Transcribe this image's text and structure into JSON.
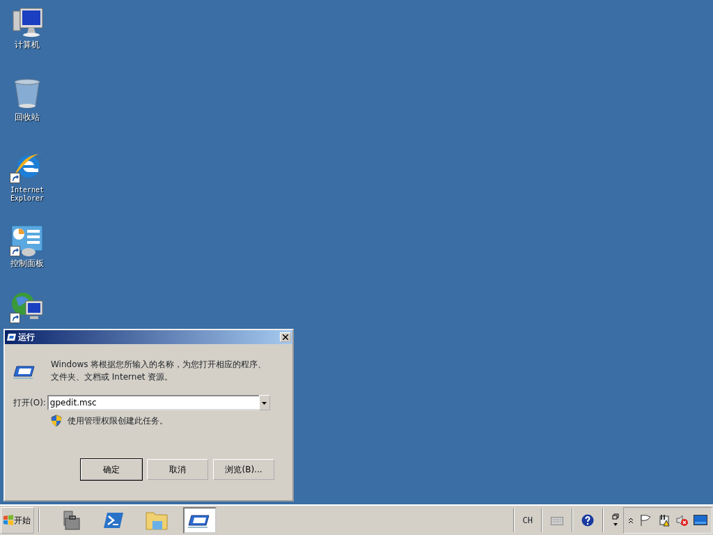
{
  "desktop_icons": [
    {
      "kind": "computer",
      "label": "计算机"
    },
    {
      "kind": "recycle",
      "label": "回收站"
    },
    {
      "kind": "ie",
      "label": "Internet Explorer",
      "shortcut": true
    },
    {
      "kind": "control",
      "label": "控制面板",
      "shortcut": true
    },
    {
      "kind": "network",
      "shortcut": true
    }
  ],
  "dialog": {
    "title": "运行",
    "description": "Windows 将根据您所输入的名称，为您打开相应的程序、文件夹、文档或 Internet 资源。",
    "open_label": "打开(O):",
    "open_value": "gpedit.msc",
    "admin_note": "使用管理权限创建此任务。",
    "buttons": [
      {
        "label": "确定",
        "default": true
      },
      {
        "label": "取消",
        "default": false
      },
      {
        "label": "浏览(B)...",
        "default": false
      }
    ]
  },
  "taskbar": {
    "start_label": "开始",
    "items": [
      {
        "kind": "server",
        "selected": false
      },
      {
        "kind": "powershell",
        "selected": false
      },
      {
        "kind": "explorer",
        "selected": false
      },
      {
        "kind": "run",
        "selected": true
      }
    ],
    "language": "CH"
  }
}
